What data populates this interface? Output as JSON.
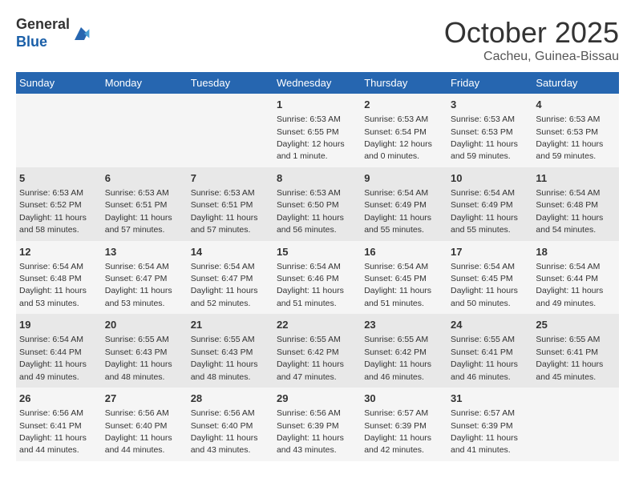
{
  "header": {
    "logo_line1": "General",
    "logo_line2": "Blue",
    "month": "October 2025",
    "location": "Cacheu, Guinea-Bissau"
  },
  "weekdays": [
    "Sunday",
    "Monday",
    "Tuesday",
    "Wednesday",
    "Thursday",
    "Friday",
    "Saturday"
  ],
  "weeks": [
    [
      {
        "day": "",
        "info": ""
      },
      {
        "day": "",
        "info": ""
      },
      {
        "day": "",
        "info": ""
      },
      {
        "day": "1",
        "info": "Sunrise: 6:53 AM\nSunset: 6:55 PM\nDaylight: 12 hours\nand 1 minute."
      },
      {
        "day": "2",
        "info": "Sunrise: 6:53 AM\nSunset: 6:54 PM\nDaylight: 12 hours\nand 0 minutes."
      },
      {
        "day": "3",
        "info": "Sunrise: 6:53 AM\nSunset: 6:53 PM\nDaylight: 11 hours\nand 59 minutes."
      },
      {
        "day": "4",
        "info": "Sunrise: 6:53 AM\nSunset: 6:53 PM\nDaylight: 11 hours\nand 59 minutes."
      }
    ],
    [
      {
        "day": "5",
        "info": "Sunrise: 6:53 AM\nSunset: 6:52 PM\nDaylight: 11 hours\nand 58 minutes."
      },
      {
        "day": "6",
        "info": "Sunrise: 6:53 AM\nSunset: 6:51 PM\nDaylight: 11 hours\nand 57 minutes."
      },
      {
        "day": "7",
        "info": "Sunrise: 6:53 AM\nSunset: 6:51 PM\nDaylight: 11 hours\nand 57 minutes."
      },
      {
        "day": "8",
        "info": "Sunrise: 6:53 AM\nSunset: 6:50 PM\nDaylight: 11 hours\nand 56 minutes."
      },
      {
        "day": "9",
        "info": "Sunrise: 6:54 AM\nSunset: 6:49 PM\nDaylight: 11 hours\nand 55 minutes."
      },
      {
        "day": "10",
        "info": "Sunrise: 6:54 AM\nSunset: 6:49 PM\nDaylight: 11 hours\nand 55 minutes."
      },
      {
        "day": "11",
        "info": "Sunrise: 6:54 AM\nSunset: 6:48 PM\nDaylight: 11 hours\nand 54 minutes."
      }
    ],
    [
      {
        "day": "12",
        "info": "Sunrise: 6:54 AM\nSunset: 6:48 PM\nDaylight: 11 hours\nand 53 minutes."
      },
      {
        "day": "13",
        "info": "Sunrise: 6:54 AM\nSunset: 6:47 PM\nDaylight: 11 hours\nand 53 minutes."
      },
      {
        "day": "14",
        "info": "Sunrise: 6:54 AM\nSunset: 6:47 PM\nDaylight: 11 hours\nand 52 minutes."
      },
      {
        "day": "15",
        "info": "Sunrise: 6:54 AM\nSunset: 6:46 PM\nDaylight: 11 hours\nand 51 minutes."
      },
      {
        "day": "16",
        "info": "Sunrise: 6:54 AM\nSunset: 6:45 PM\nDaylight: 11 hours\nand 51 minutes."
      },
      {
        "day": "17",
        "info": "Sunrise: 6:54 AM\nSunset: 6:45 PM\nDaylight: 11 hours\nand 50 minutes."
      },
      {
        "day": "18",
        "info": "Sunrise: 6:54 AM\nSunset: 6:44 PM\nDaylight: 11 hours\nand 49 minutes."
      }
    ],
    [
      {
        "day": "19",
        "info": "Sunrise: 6:54 AM\nSunset: 6:44 PM\nDaylight: 11 hours\nand 49 minutes."
      },
      {
        "day": "20",
        "info": "Sunrise: 6:55 AM\nSunset: 6:43 PM\nDaylight: 11 hours\nand 48 minutes."
      },
      {
        "day": "21",
        "info": "Sunrise: 6:55 AM\nSunset: 6:43 PM\nDaylight: 11 hours\nand 48 minutes."
      },
      {
        "day": "22",
        "info": "Sunrise: 6:55 AM\nSunset: 6:42 PM\nDaylight: 11 hours\nand 47 minutes."
      },
      {
        "day": "23",
        "info": "Sunrise: 6:55 AM\nSunset: 6:42 PM\nDaylight: 11 hours\nand 46 minutes."
      },
      {
        "day": "24",
        "info": "Sunrise: 6:55 AM\nSunset: 6:41 PM\nDaylight: 11 hours\nand 46 minutes."
      },
      {
        "day": "25",
        "info": "Sunrise: 6:55 AM\nSunset: 6:41 PM\nDaylight: 11 hours\nand 45 minutes."
      }
    ],
    [
      {
        "day": "26",
        "info": "Sunrise: 6:56 AM\nSunset: 6:41 PM\nDaylight: 11 hours\nand 44 minutes."
      },
      {
        "day": "27",
        "info": "Sunrise: 6:56 AM\nSunset: 6:40 PM\nDaylight: 11 hours\nand 44 minutes."
      },
      {
        "day": "28",
        "info": "Sunrise: 6:56 AM\nSunset: 6:40 PM\nDaylight: 11 hours\nand 43 minutes."
      },
      {
        "day": "29",
        "info": "Sunrise: 6:56 AM\nSunset: 6:39 PM\nDaylight: 11 hours\nand 43 minutes."
      },
      {
        "day": "30",
        "info": "Sunrise: 6:57 AM\nSunset: 6:39 PM\nDaylight: 11 hours\nand 42 minutes."
      },
      {
        "day": "31",
        "info": "Sunrise: 6:57 AM\nSunset: 6:39 PM\nDaylight: 11 hours\nand 41 minutes."
      },
      {
        "day": "",
        "info": ""
      }
    ]
  ]
}
